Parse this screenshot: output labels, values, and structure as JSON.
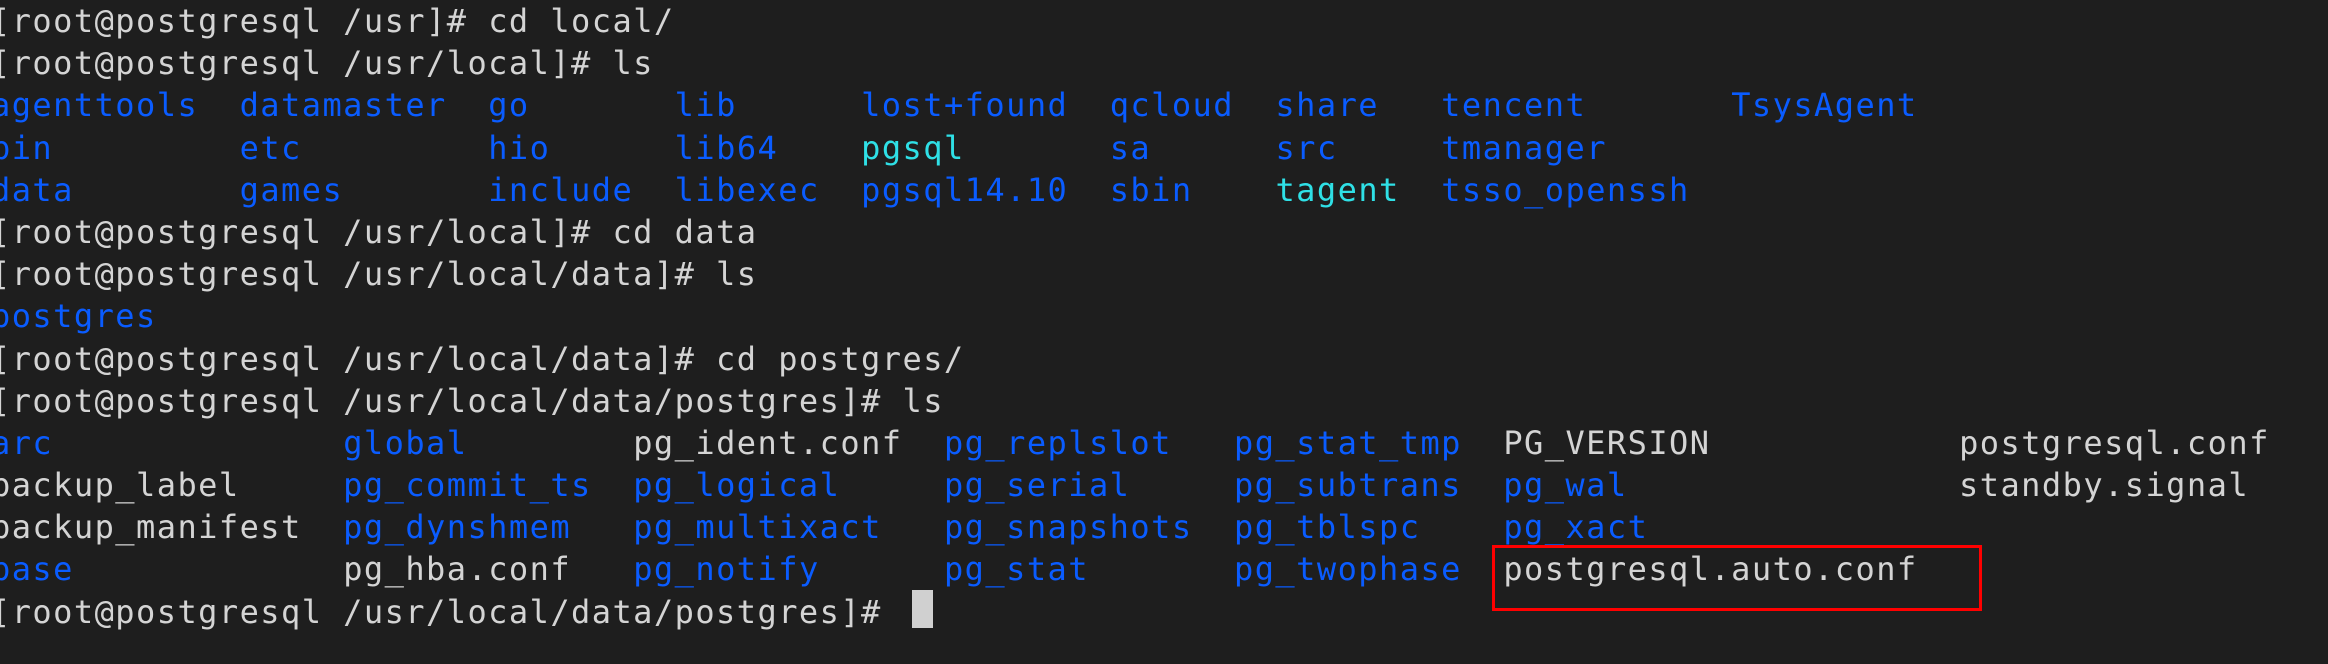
{
  "colors": {
    "background": "#1e1e1e",
    "file": "#d4d4d4",
    "directory": "#0a5cff",
    "executable": "#2fe0e6",
    "highlight_box": "#ff0000"
  },
  "lines": [
    {
      "type": "prompt",
      "prompt": "[root@postgresql /usr]# ",
      "command": "cd local/"
    },
    {
      "type": "prompt",
      "prompt": "[root@postgresql /usr/local]# ",
      "command": "ls"
    },
    {
      "type": "ls",
      "columns": [
        [
          {
            "name": "agenttools",
            "kind": "dir"
          },
          {
            "name": "bin",
            "kind": "dir"
          },
          {
            "name": "data",
            "kind": "dir"
          }
        ],
        [
          {
            "name": "datamaster",
            "kind": "dir"
          },
          {
            "name": "etc",
            "kind": "dir"
          },
          {
            "name": "games",
            "kind": "dir"
          }
        ],
        [
          {
            "name": "go",
            "kind": "dir"
          },
          {
            "name": "hio",
            "kind": "dir"
          },
          {
            "name": "include",
            "kind": "dir"
          }
        ],
        [
          {
            "name": "lib",
            "kind": "dir"
          },
          {
            "name": "lib64",
            "kind": "dir"
          },
          {
            "name": "libexec",
            "kind": "dir"
          }
        ],
        [
          {
            "name": "lost+found",
            "kind": "dir"
          },
          {
            "name": "pgsql",
            "kind": "exe"
          },
          {
            "name": "pgsql14.10",
            "kind": "dir"
          }
        ],
        [
          {
            "name": "qcloud",
            "kind": "dir"
          },
          {
            "name": "sa",
            "kind": "dir"
          },
          {
            "name": "sbin",
            "kind": "dir"
          }
        ],
        [
          {
            "name": "share",
            "kind": "dir"
          },
          {
            "name": "src",
            "kind": "dir"
          },
          {
            "name": "tagent",
            "kind": "exe"
          }
        ],
        [
          {
            "name": "tencent",
            "kind": "dir"
          },
          {
            "name": "tmanager",
            "kind": "dir"
          },
          {
            "name": "tsso_openssh",
            "kind": "dir"
          }
        ],
        [
          {
            "name": "TsysAgent",
            "kind": "dir"
          }
        ]
      ]
    },
    {
      "type": "prompt",
      "prompt": "[root@postgresql /usr/local]# ",
      "command": "cd data"
    },
    {
      "type": "prompt",
      "prompt": "[root@postgresql /usr/local/data]# ",
      "command": "ls"
    },
    {
      "type": "ls",
      "columns": [
        [
          {
            "name": "postgres",
            "kind": "dir"
          }
        ]
      ]
    },
    {
      "type": "prompt",
      "prompt": "[root@postgresql /usr/local/data]# ",
      "command": "cd postgres/"
    },
    {
      "type": "prompt",
      "prompt": "[root@postgresql /usr/local/data/postgres]# ",
      "command": "ls"
    },
    {
      "type": "ls",
      "columns": [
        [
          {
            "name": "arc",
            "kind": "dir"
          },
          {
            "name": "backup_label",
            "kind": "file"
          },
          {
            "name": "backup_manifest",
            "kind": "file"
          },
          {
            "name": "base",
            "kind": "dir"
          }
        ],
        [
          {
            "name": "global",
            "kind": "dir"
          },
          {
            "name": "pg_commit_ts",
            "kind": "dir"
          },
          {
            "name": "pg_dynshmem",
            "kind": "dir"
          },
          {
            "name": "pg_hba.conf",
            "kind": "file"
          }
        ],
        [
          {
            "name": "pg_ident.conf",
            "kind": "file"
          },
          {
            "name": "pg_logical",
            "kind": "dir"
          },
          {
            "name": "pg_multixact",
            "kind": "dir"
          },
          {
            "name": "pg_notify",
            "kind": "dir"
          }
        ],
        [
          {
            "name": "pg_replslot",
            "kind": "dir"
          },
          {
            "name": "pg_serial",
            "kind": "dir"
          },
          {
            "name": "pg_snapshots",
            "kind": "dir"
          },
          {
            "name": "pg_stat",
            "kind": "dir"
          }
        ],
        [
          {
            "name": "pg_stat_tmp",
            "kind": "dir"
          },
          {
            "name": "pg_subtrans",
            "kind": "dir"
          },
          {
            "name": "pg_tblspc",
            "kind": "dir"
          },
          {
            "name": "pg_twophase",
            "kind": "dir"
          }
        ],
        [
          {
            "name": "PG_VERSION",
            "kind": "file"
          },
          {
            "name": "pg_wal",
            "kind": "dir"
          },
          {
            "name": "pg_xact",
            "kind": "dir"
          },
          {
            "name": "postgresql.auto.conf",
            "kind": "file"
          }
        ],
        [
          {
            "name": "postgresql.conf",
            "kind": "file"
          },
          {
            "name": "standby.signal",
            "kind": "file"
          }
        ]
      ]
    },
    {
      "type": "prompt",
      "prompt": "[root@postgresql /usr/local/data/postgres]# ",
      "command": ""
    }
  ]
}
